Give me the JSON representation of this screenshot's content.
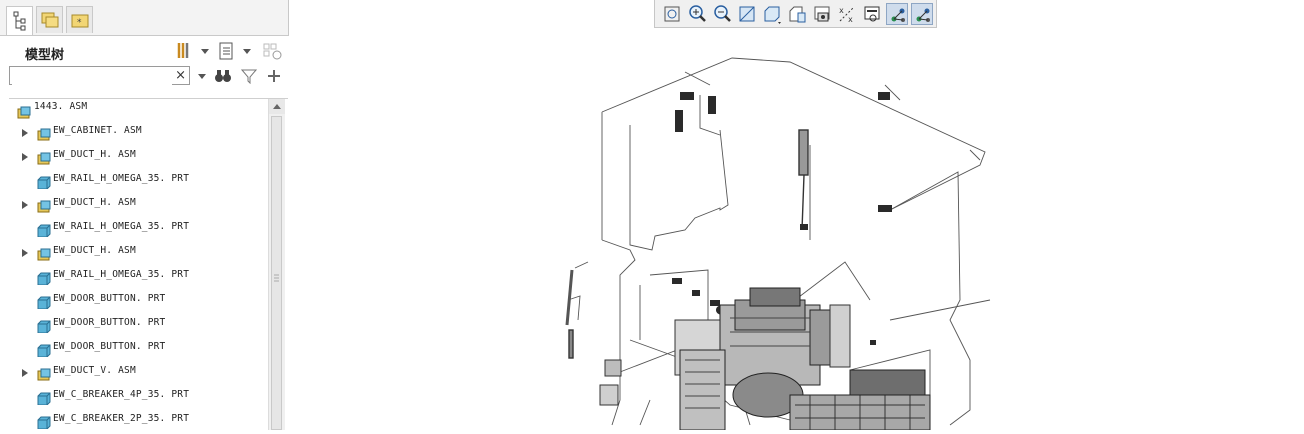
{
  "model_tree": {
    "title": "模型树",
    "search": {
      "value": "",
      "placeholder": ""
    },
    "clear_glyph": "×",
    "items": [
      {
        "label": "1443. ASM",
        "type": "asm",
        "expandable": false,
        "root": true
      },
      {
        "label": "EW_CABINET. ASM",
        "type": "asm",
        "expandable": true
      },
      {
        "label": "EW_DUCT_H. ASM",
        "type": "asm",
        "expandable": true
      },
      {
        "label": "EW_RAIL_H_OMEGA_35. PRT",
        "type": "prt",
        "expandable": false
      },
      {
        "label": "EW_DUCT_H. ASM",
        "type": "asm",
        "expandable": true
      },
      {
        "label": "EW_RAIL_H_OMEGA_35. PRT",
        "type": "prt",
        "expandable": false
      },
      {
        "label": "EW_DUCT_H. ASM",
        "type": "asm",
        "expandable": true
      },
      {
        "label": "EW_RAIL_H_OMEGA_35. PRT",
        "type": "prt",
        "expandable": false
      },
      {
        "label": "EW_DOOR_BUTTON. PRT",
        "type": "prt",
        "expandable": false
      },
      {
        "label": "EW_DOOR_BUTTON. PRT",
        "type": "prt",
        "expandable": false
      },
      {
        "label": "EW_DOOR_BUTTON. PRT",
        "type": "prt",
        "expandable": false
      },
      {
        "label": "EW_DUCT_V. ASM",
        "type": "asm",
        "expandable": true
      },
      {
        "label": "EW_C_BREAKER_4P_35. PRT",
        "type": "prt",
        "expandable": false
      },
      {
        "label": "EW_C_BREAKER_2P_35. PRT",
        "type": "prt",
        "expandable": false
      }
    ]
  },
  "view_toolbar": {
    "buttons": [
      {
        "icon": "refit-icon",
        "active": false
      },
      {
        "icon": "zoom-in-icon",
        "active": false
      },
      {
        "icon": "zoom-out-icon",
        "active": false
      },
      {
        "icon": "repaint-icon",
        "active": false
      },
      {
        "icon": "display-style-icon",
        "active": false
      },
      {
        "icon": "saved-orientations-icon",
        "active": false
      },
      {
        "icon": "view-manager-icon",
        "active": false
      },
      {
        "icon": "perspective-icon",
        "active": false
      },
      {
        "icon": "annotation-display-icon",
        "active": false
      },
      {
        "icon": "spin-center-icon",
        "active": true
      },
      {
        "icon": "datum-display-icon",
        "active": true
      }
    ]
  },
  "colors": {
    "accent": "#cfdcec",
    "asm_icon": "#e6c85a",
    "prt_icon": "#5ab3d8"
  }
}
